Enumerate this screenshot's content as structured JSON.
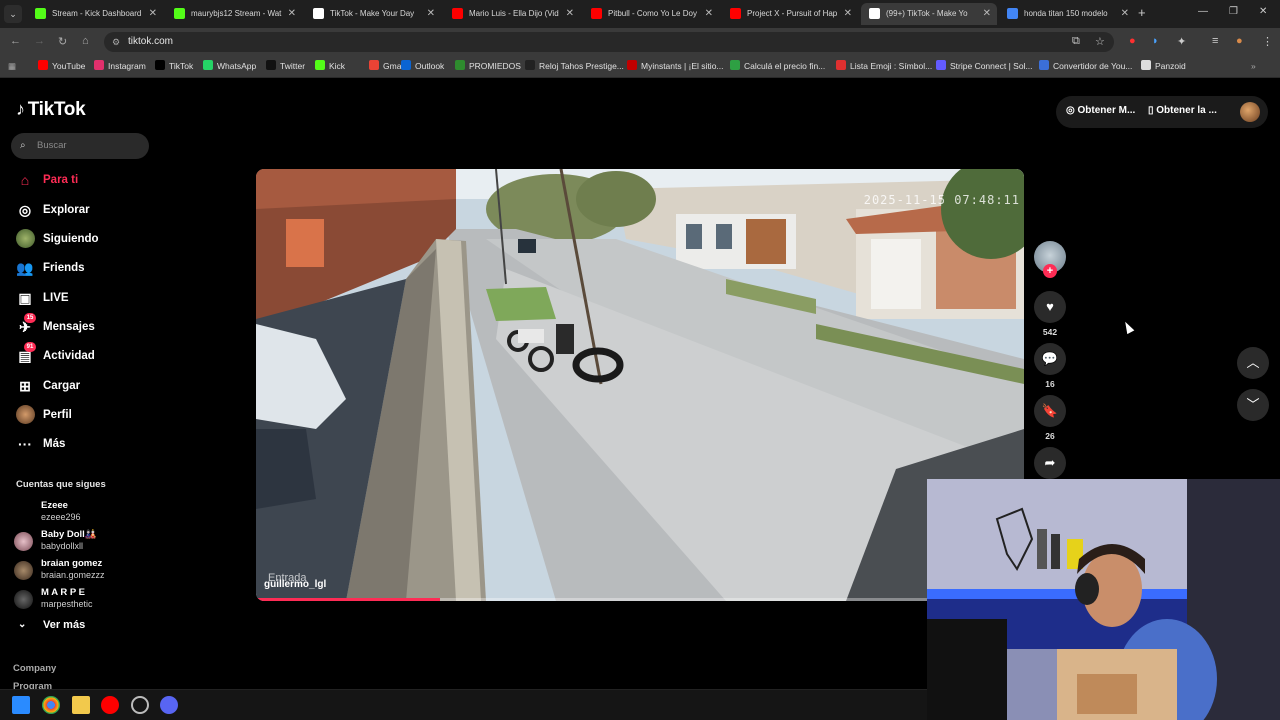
{
  "browser": {
    "tabs": [
      {
        "title": "Stream - Kick Dashboard",
        "favicon": "kick-icon",
        "color": "#53fc18",
        "active": false
      },
      {
        "title": "maurybjs12 Stream - Wat",
        "favicon": "kick-icon",
        "color": "#53fc18",
        "active": false
      },
      {
        "title": "TikTok - Make Your Day",
        "favicon": "tiktok-icon",
        "color": "#ffffff",
        "active": false
      },
      {
        "title": "Mario Luis - Ella Dijo (Vid",
        "favicon": "youtube-icon",
        "color": "#ff0000",
        "active": false
      },
      {
        "title": "Pitbull - Como Yo Le Doy",
        "favicon": "youtube-icon",
        "color": "#ff0000",
        "active": false
      },
      {
        "title": "Project X - Pursuit of Hap",
        "favicon": "youtube-icon",
        "color": "#ff0000",
        "active": false
      },
      {
        "title": "(99+) TikTok - Make Yo",
        "favicon": "tiktok-icon",
        "color": "#ffffff",
        "active": true
      },
      {
        "title": "honda titan 150 modelo",
        "favicon": "google-icon",
        "color": "#4285f4",
        "active": false
      }
    ],
    "url": "tiktok.com",
    "bookmarks": [
      {
        "label": "YouTube",
        "icon": "youtube-icon",
        "color": "#ff0000"
      },
      {
        "label": "Instagram",
        "icon": "instagram-icon",
        "color": "#e1306c"
      },
      {
        "label": "TikTok",
        "icon": "tiktok-icon",
        "color": "#000000"
      },
      {
        "label": "WhatsApp",
        "icon": "whatsapp-icon",
        "color": "#25d366"
      },
      {
        "label": "Twitter",
        "icon": "twitter-icon",
        "color": "#111111"
      },
      {
        "label": "Kick",
        "icon": "kick-icon",
        "color": "#53fc18"
      },
      {
        "label": "Gmail",
        "icon": "gmail-icon",
        "color": "#ea4335"
      },
      {
        "label": "Outlook",
        "icon": "outlook-icon",
        "color": "#0a64d2"
      },
      {
        "label": "PROMIEDOS",
        "icon": "promiedos-icon",
        "color": "#2e8b2e"
      },
      {
        "label": "Reloj Tahos Prestige...",
        "icon": "store-icon",
        "color": "#222222"
      },
      {
        "label": "Myinstants | ¡El sitio...",
        "icon": "myinstants-icon",
        "color": "#c00000"
      },
      {
        "label": "Calculá el precio fin...",
        "icon": "calc-icon",
        "color": "#2ea043"
      },
      {
        "label": "Lista Emoji : Símbol...",
        "icon": "emoji-icon",
        "color": "#e03030"
      },
      {
        "label": "Stripe Connect | Sol...",
        "icon": "stripe-icon",
        "color": "#635bff"
      },
      {
        "label": "Convertidor de You...",
        "icon": "converter-icon",
        "color": "#3b6fd8"
      },
      {
        "label": "Panzoid",
        "icon": "panzoid-icon",
        "color": "#dddddd"
      }
    ]
  },
  "tiktok": {
    "logo": "TikTok",
    "search_placeholder": "Buscar",
    "nav": [
      {
        "label": "Para ti",
        "icon": "home-icon",
        "glyph": "⌂",
        "active": true,
        "badge": ""
      },
      {
        "label": "Explorar",
        "icon": "compass-icon",
        "glyph": "◎",
        "active": false,
        "badge": ""
      },
      {
        "label": "Siguiendo",
        "icon": "following-avatar-icon",
        "glyph": "",
        "active": false,
        "badge": ""
      },
      {
        "label": "Friends",
        "icon": "friends-icon",
        "glyph": "👥",
        "active": false,
        "badge": ""
      },
      {
        "label": "LIVE",
        "icon": "live-icon",
        "glyph": "▣",
        "active": false,
        "badge": ""
      },
      {
        "label": "Mensajes",
        "icon": "messages-icon",
        "glyph": "✈",
        "active": false,
        "badge": "15"
      },
      {
        "label": "Actividad",
        "icon": "activity-icon",
        "glyph": "▤",
        "active": false,
        "badge": "91"
      },
      {
        "label": "Cargar",
        "icon": "upload-icon",
        "glyph": "⊞",
        "active": false,
        "badge": ""
      },
      {
        "label": "Perfil",
        "icon": "profile-avatar-icon",
        "glyph": "",
        "active": false,
        "badge": ""
      },
      {
        "label": "Más",
        "icon": "more-icon",
        "glyph": "···",
        "active": false,
        "badge": ""
      }
    ],
    "following_title": "Cuentas que sigues",
    "following": [
      {
        "name": "Ezeee",
        "handle": "ezeee296"
      },
      {
        "name": "Baby Doll🎎",
        "handle": "babydollxll"
      },
      {
        "name": "braian gomez",
        "handle": "braian.gomezzz"
      },
      {
        "name": "M A R P E",
        "handle": "marpesthetic"
      }
    ],
    "see_more": "Ver más",
    "footer": [
      "Company",
      "Program"
    ],
    "top_right": {
      "get_coins": "Obtener M...",
      "get_app": "Obtener la ..."
    },
    "video": {
      "timestamp": "2025-11-15 07:48:11",
      "location_label": "Entrada",
      "author": "guillermo_lgl",
      "progress": 0.24
    },
    "actions": {
      "likes": "542",
      "comments": "16",
      "saves": "26"
    }
  }
}
